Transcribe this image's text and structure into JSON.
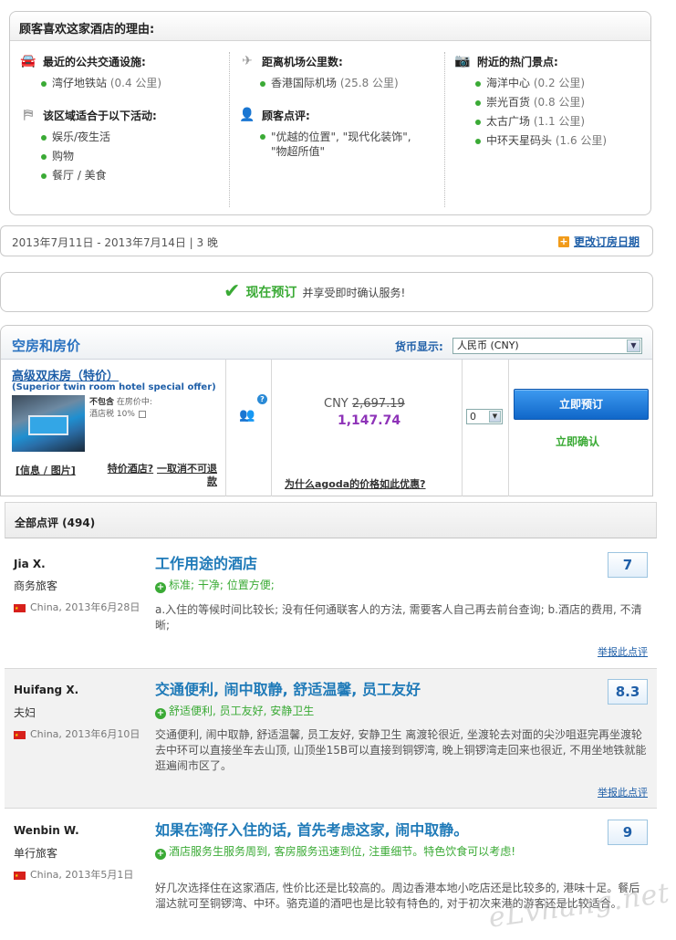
{
  "reasons": {
    "title": "顾客喜欢这家酒店的理由:",
    "transport": {
      "heading": "最近的公共交通设施:",
      "items": [
        {
          "name": "湾仔地铁站",
          "dist": "(0.4 公里)"
        }
      ]
    },
    "activities": {
      "heading": "该区域适合于以下活动:",
      "items": [
        "娱乐/夜生活",
        "购物",
        "餐厅 / 美食"
      ]
    },
    "airport": {
      "heading": "距离机场公里数:",
      "items": [
        {
          "name": "香港国际机场",
          "dist": "(25.8 公里)"
        }
      ]
    },
    "comments": {
      "heading": "顾客点评:",
      "text": "\"优越的位置\", \"现代化装饰\", \"物超所值\""
    },
    "attractions": {
      "heading": "附近的热门景点:",
      "items": [
        {
          "name": "海洋中心",
          "dist": "(0.2 公里)"
        },
        {
          "name": "崇光百货",
          "dist": "(0.8 公里)"
        },
        {
          "name": "太古广场",
          "dist": "(1.1 公里)"
        },
        {
          "name": "中环天星码头",
          "dist": "(1.6 公里)"
        }
      ]
    }
  },
  "dates": {
    "text": "2013年7月11日 - 2013年7月14日 | 3 晚",
    "change_label": "更改订房日期",
    "plus": "+"
  },
  "booknow": {
    "check": "✔",
    "strong": "现在预订",
    "rest": "并享受即时确认服务!"
  },
  "availability": {
    "title": "空房和房价",
    "currency_label": "货币显示:",
    "currency_value": "人民币  (CNY)",
    "room": {
      "name": "高级双床房（特价）",
      "subtitle": "(Superior twin room hotel special offer)",
      "note_bold": "不包含",
      "note_rest": "在房价中:",
      "note_tax": "酒店税 10%",
      "links": "[信息 / 图片]",
      "special_a": "特价酒店?",
      "special_b": "一取消不可退款",
      "old_price_currency": "CNY",
      "old_price": "2,697.19",
      "new_price": "1,147.74",
      "why": "为什么agoda的价格如此优惠?",
      "qty": "0",
      "book_button": "立即预订",
      "instant": "立即确认",
      "occupancy_help": "?"
    }
  },
  "reviews": {
    "header": "全部点评 (494)",
    "report_label": "举报此点评",
    "items": [
      {
        "name": "Jia X.",
        "type": "商务旅客",
        "loc": "China, 2013年6月28日",
        "title": "工作用途的酒店",
        "pos": "标准; 干净; 位置方便;",
        "body": "a.入住的等候时间比较长; 没有任何通联客人的方法, 需要客人自己再去前台查询;  b.酒店的费用, 不清晰;",
        "score": "7"
      },
      {
        "name": "Huifang X.",
        "type": "夫妇",
        "loc": "China, 2013年6月10日",
        "title": "交通便利, 闹中取静, 舒适温馨, 员工友好",
        "pos": "舒适便利, 员工友好, 安静卫生",
        "body": "交通便利, 闹中取静, 舒适温馨, 员工友好, 安静卫生 离渡轮很近, 坐渡轮去对面的尖沙咀逛完再坐渡轮去中环可以直接坐车去山顶, 山顶坐15B可以直接到铜锣湾, 晚上铜锣湾走回来也很近, 不用坐地铁就能逛遍闹市区了。",
        "score": "8.3"
      },
      {
        "name": "Wenbin W.",
        "type": "单行旅客",
        "loc": "China, 2013年5月1日",
        "title": "如果在湾仔入住的话, 首先考虑这家, 闹中取静。",
        "pos": "酒店服务生服务周到, 客房服务迅速到位, 注重细节。特色饮食可以考虑!",
        "body": "好几次选择住在这家酒店, 性价比还是比较高的。周边香港本地小吃店还是比较多的, 港味十足。餐后溜达就可至铜锣湾、中环。骆克道的酒吧也是比较有特色的, 对于初次来港的游客还是比较适合。",
        "score": "9"
      }
    ]
  },
  "watermark": "eLvhang.net"
}
